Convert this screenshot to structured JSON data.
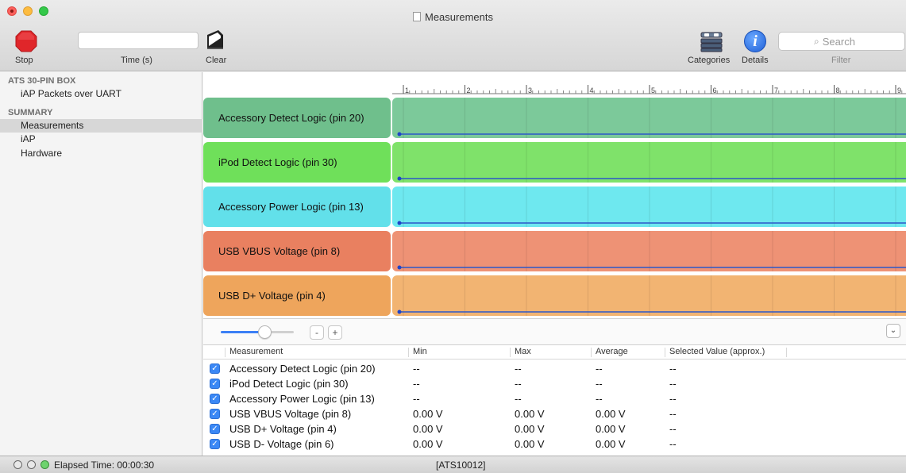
{
  "window": {
    "title": "Measurements"
  },
  "toolbar": {
    "stop_label": "Stop",
    "time_label": "Time (s)",
    "time_value": "",
    "clear_label": "Clear",
    "categories_label": "Categories",
    "details_label": "Details",
    "search_placeholder": "Search",
    "filter_label": "Filter"
  },
  "sidebar": {
    "section1": "ATS 30-PIN BOX",
    "section1_items": [
      "iAP Packets over UART"
    ],
    "section2": "SUMMARY",
    "section2_items": [
      "Measurements",
      "iAP",
      "Hardware"
    ],
    "selected": "Measurements"
  },
  "ruler": {
    "ticks": [
      "1",
      "2",
      "3",
      "4",
      "5",
      "6",
      "7",
      "8",
      "9"
    ]
  },
  "signals": [
    {
      "label": "Accessory Detect Logic (pin 20)",
      "label_color": "#6fbf8c",
      "track_color": "#7cc99a"
    },
    {
      "label": "iPod Detect Logic (pin 30)",
      "label_color": "#6fe05a",
      "track_color": "#7fe26a"
    },
    {
      "label": "Accessory Power Logic (pin 13)",
      "label_color": "#62e0ea",
      "track_color": "#6ee8ef"
    },
    {
      "label": "USB VBUS Voltage (pin 8)",
      "label_color": "#e98060",
      "track_color": "#ee9275"
    },
    {
      "label": "USB D+ Voltage (pin 4)",
      "label_color": "#eea55c",
      "track_color": "#f2b472"
    }
  ],
  "zoom": {
    "minus": "-",
    "plus": "+",
    "level": 0.6
  },
  "table": {
    "headers": [
      "Measurement",
      "Min",
      "Max",
      "Average",
      "Selected Value (approx.)"
    ],
    "rows": [
      {
        "name": "Accessory Detect Logic (pin 20)",
        "min": "--",
        "max": "--",
        "avg": "--",
        "sel": "--"
      },
      {
        "name": "iPod Detect Logic (pin 30)",
        "min": "--",
        "max": "--",
        "avg": "--",
        "sel": "--"
      },
      {
        "name": "Accessory Power Logic (pin 13)",
        "min": "--",
        "max": "--",
        "avg": "--",
        "sel": "--"
      },
      {
        "name": "USB VBUS Voltage (pin 8)",
        "min": "0.00 V",
        "max": "0.00 V",
        "avg": "0.00 V",
        "sel": "--"
      },
      {
        "name": "USB D+ Voltage (pin 4)",
        "min": "0.00 V",
        "max": "0.00 V",
        "avg": "0.00 V",
        "sel": "--"
      },
      {
        "name": "USB D- Voltage (pin 6)",
        "min": "0.00 V",
        "max": "0.00 V",
        "avg": "0.00 V",
        "sel": "--"
      }
    ]
  },
  "status": {
    "elapsed": "Elapsed Time: 00:00:30",
    "device": "[ATS10012]"
  }
}
